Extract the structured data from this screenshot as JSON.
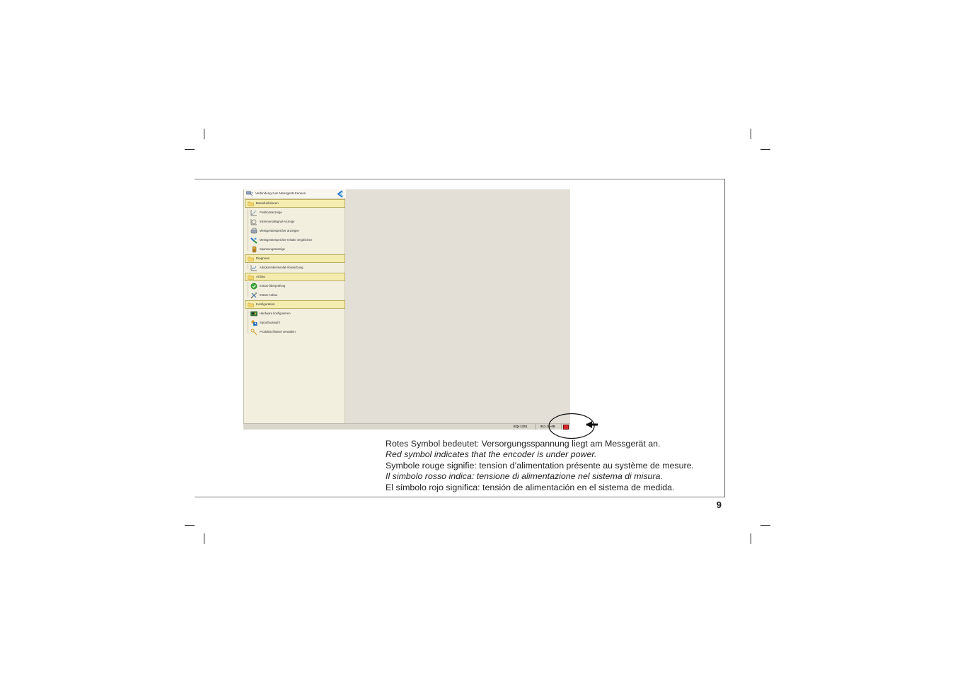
{
  "page": {
    "number": "9"
  },
  "screenshot": {
    "connect_label": "Verbindung zum Messgerät trennen",
    "groups": [
      {
        "label": "Basisfunktionen",
        "items": [
          {
            "label": "Positionsanzeige",
            "icon": "position-graph-icon"
          },
          {
            "label": "Inkrementalsignal-Anzeige",
            "icon": "lissajous-icon"
          },
          {
            "label": "Messgerätespeicher anzeigen",
            "icon": "memory-chip-icon"
          },
          {
            "label": "Messgerätespeicher-Inhalte vergleichen",
            "icon": "compare-icon"
          },
          {
            "label": "Spannungsanzeige",
            "icon": "battery-icon"
          }
        ]
      },
      {
        "label": "Diagnose",
        "items": [
          {
            "label": "Absolut-Inkremental-Abweichung",
            "icon": "deviation-graph-icon"
          }
        ]
      },
      {
        "label": "Anbau",
        "items": [
          {
            "label": "EnDat-Überprüfung",
            "icon": "check-icon"
          },
          {
            "label": "EnDat-Anbau",
            "icon": "tools-icon"
          }
        ]
      },
      {
        "label": "Konfiguration",
        "items": [
          {
            "label": "Hardware konfigurieren",
            "icon": "hardware-board-icon"
          },
          {
            "label": "Sprachauswahl",
            "icon": "language-icon"
          },
          {
            "label": "Produktschlüssel verwalten",
            "icon": "keys-icon"
          }
        ]
      }
    ],
    "status": {
      "device": "EQI 1331",
      "id": "811 16-08",
      "power_symbol_color": "#d8262b"
    }
  },
  "captions": [
    {
      "text": "Rotes Symbol bedeutet: Versorgungsspannung liegt am Messgerät an.",
      "italic": false
    },
    {
      "text": "Red symbol indicates that the encoder is under power.",
      "italic": true
    },
    {
      "text": "Symbole rouge signifie: tension d’alimentation présente au système de mesure.",
      "italic": false
    },
    {
      "text": "Il simbolo rosso indica: tensione di alimentazione nel sistema di misura.",
      "italic": true
    },
    {
      "text": "El símbolo rojo significa: tensión de alimentación en el sistema de medida.",
      "italic": false
    }
  ]
}
